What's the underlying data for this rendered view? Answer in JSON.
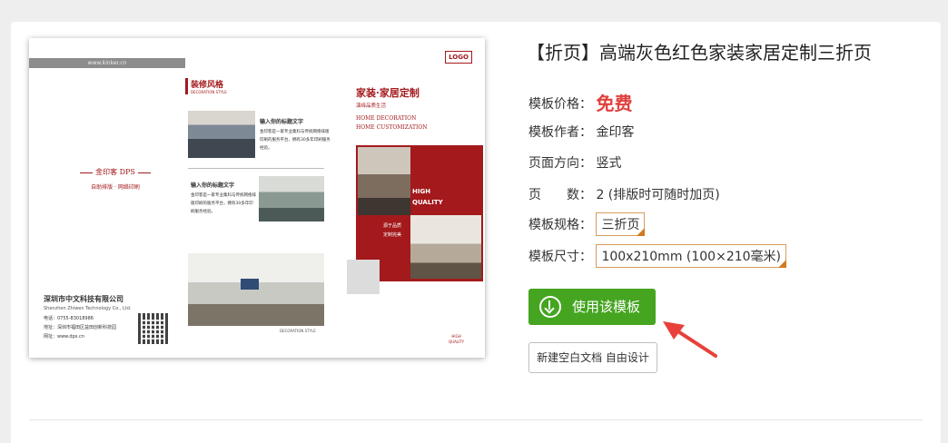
{
  "preview": {
    "url": "www.kinker.cn",
    "logo": "LOGO",
    "left_brand_title": "金印客 DPS",
    "left_brand_slogan": "自助排版 · 网络印刷",
    "company_name": "深圳市中文科技有限公司",
    "company_en": "Shenzhen Zhiwen Technology Co., Ltd.",
    "phone": "电话：0755-83018986",
    "address": "地址：深圳市福田区益田创新科技园",
    "website": "网址：www.dps.cn",
    "mid_title": "装修风格",
    "mid_subtitle": "DECORATION STYLE",
    "block1_heading": "输入你的标题文字",
    "block1_text": "金印客是一家专业集科与传统网络排版印刷的服务平台，拥有30多年印刷服务经验。",
    "block2_heading": "输入你的标题文字",
    "block2_text": "金印客是一家专业集科与传统网络排版印刷的服务平台，拥有30多年印刷服务经验。",
    "decoration_style": "DECORATION STYLE",
    "right_title": "家装·家居定制",
    "right_sub": "演绎品质生活",
    "right_en1": "HOME DECORATION",
    "right_en2": "HOME CUSTOMIZATION",
    "hq1": "HIGH",
    "hq2": "QUALITY",
    "red_text1": "源于品质",
    "red_text2": "定制完美",
    "bottom_hq1": "HIGH",
    "bottom_hq2": "QUALITY"
  },
  "info": {
    "title": "【折页】高端灰色红色家装家居定制三折页",
    "price_label": "模板价格：",
    "price_value": "免费",
    "author_label": "模板作者：",
    "author_value": "金印客",
    "orientation_label": "页面方向：",
    "orientation_value": "竖式",
    "pages_label": "页　　数：",
    "pages_value": "2 (排版时可随时加页)",
    "spec_label": "模板规格：",
    "spec_value": "三折页",
    "size_label": "模板尺寸：",
    "size_value": "100x210mm (100×210毫米)"
  },
  "actions": {
    "use_template": "使用该模板",
    "new_blank": "新建空白文档 自由设计"
  },
  "colors": {
    "accent_red": "#a3191c",
    "price_red": "#e0413c",
    "button_green": "#45a520",
    "tag_orange": "#d27a1e"
  }
}
